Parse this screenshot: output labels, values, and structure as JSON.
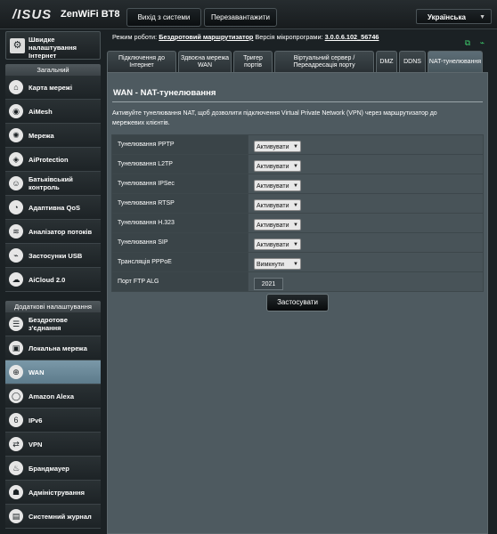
{
  "header": {
    "logo": "/ISUS",
    "model": "ZenWiFi BT8",
    "logout_label": "Вихід з системи",
    "reboot_label": "Перезавантажити",
    "language": "Українська"
  },
  "status": {
    "mode_label": "Режим роботи:",
    "mode_value": "Бездротовий маршрутизатор",
    "firmware_label": "Версія мікропрограми:",
    "firmware_value": "3.0.0.6.102_56746"
  },
  "sidebar": {
    "quick_setup": "Швидке налаштування Інтернет",
    "general_header": "Загальний",
    "general_items": [
      {
        "label": "Карта мережі",
        "icon": "network-map-icon"
      },
      {
        "label": "AiMesh",
        "icon": "aimesh-icon"
      },
      {
        "label": "Мережа",
        "icon": "network-icon"
      },
      {
        "label": "AiProtection",
        "icon": "aiprotection-icon"
      },
      {
        "label": "Батьківський контроль",
        "icon": "parental-control-icon"
      },
      {
        "label": "Адаптивна QoS",
        "icon": "qos-icon"
      },
      {
        "label": "Аналізатор потоків",
        "icon": "traffic-analyzer-icon"
      },
      {
        "label": "Застосунки USB",
        "icon": "usb-icon"
      },
      {
        "label": "AiCloud 2.0",
        "icon": "aicloud-icon"
      }
    ],
    "advanced_header": "Додаткові налаштування",
    "advanced_items": [
      {
        "label": "Бездротове з'єднання",
        "icon": "wireless-icon"
      },
      {
        "label": "Локальна мережа",
        "icon": "lan-icon"
      },
      {
        "label": "WAN",
        "icon": "wan-icon"
      },
      {
        "label": "Amazon Alexa",
        "icon": "alexa-icon"
      },
      {
        "label": "IPv6",
        "icon": "ipv6-icon"
      },
      {
        "label": "VPN",
        "icon": "vpn-icon"
      },
      {
        "label": "Брандмауер",
        "icon": "firewall-icon"
      },
      {
        "label": "Адміністрування",
        "icon": "administration-icon"
      },
      {
        "label": "Системний журнал",
        "icon": "system-log-icon"
      }
    ]
  },
  "tabs": [
    "Підключення до Інтернет",
    "Здвоєна мережа WAN",
    "Тригер портів",
    "Віртуальний сервер / Переадресація порту",
    "DMZ",
    "DDNS",
    "NAT-тунелювання"
  ],
  "main": {
    "title": "WAN - NAT-тунелювання",
    "description": "Активуйте тунелювання NAT, щоб дозволити підключення Virtual Private Network (VPN) через маршрутизатор до мережевих клієнтів.",
    "rows": [
      {
        "label": "Тунелювання PPTP",
        "value": "Активувати"
      },
      {
        "label": "Тунелювання L2TP",
        "value": "Активувати"
      },
      {
        "label": "Тунелювання IPSec",
        "value": "Активувати"
      },
      {
        "label": "Тунелювання RTSP",
        "value": "Активувати"
      },
      {
        "label": "Тунелювання H.323",
        "value": "Активувати"
      },
      {
        "label": "Тунелювання SIP",
        "value": "Активувати"
      },
      {
        "label": "Трансляція PPPoE",
        "value": "Вимкнути"
      }
    ],
    "ftp_label": "Порт FTP ALG",
    "ftp_value": "2021",
    "apply_label": "Застосувати"
  }
}
